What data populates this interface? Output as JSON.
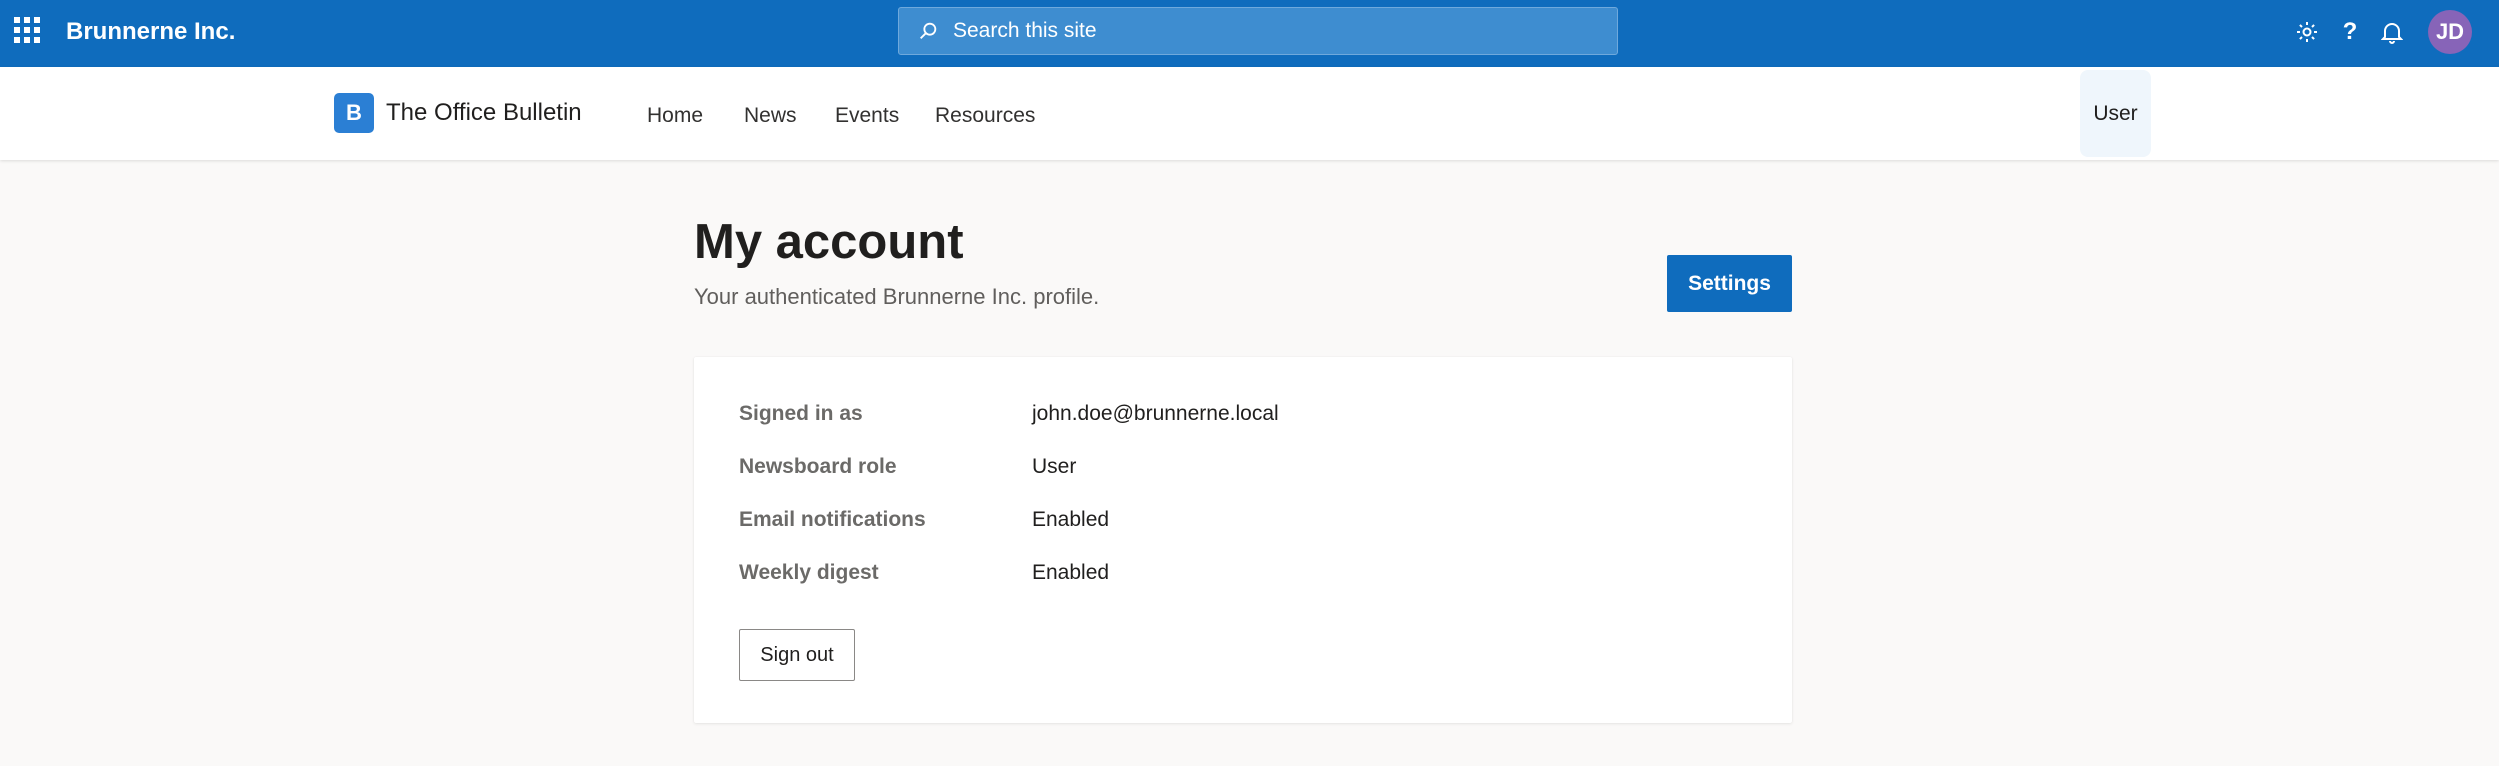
{
  "suite": {
    "brand": "Brunnerne Inc.",
    "search_placeholder": "Search this site",
    "help_glyph": "?",
    "avatar_initials": "JD",
    "icons": [
      "waffle-icon",
      "search-icon",
      "gear-icon",
      "help-icon",
      "bell-icon"
    ]
  },
  "site": {
    "logo_letter": "B",
    "title": "The Office Bulletin",
    "nav": [
      "Home",
      "News",
      "Events",
      "Resources"
    ],
    "user_tab": "User"
  },
  "main": {
    "title": "My account",
    "subtitle": "Your authenticated Brunnerne Inc. profile.",
    "settings_label": "Settings",
    "details": [
      {
        "label": "Signed in as",
        "value": "john.doe@brunnerne.local"
      },
      {
        "label": "Newsboard role",
        "value": "User"
      },
      {
        "label": "Email notifications",
        "value": "Enabled"
      },
      {
        "label": "Weekly digest",
        "value": "Enabled"
      }
    ],
    "signout_label": "Sign out"
  },
  "colors": {
    "brand_blue": "#0f6cbd",
    "avatar_purple": "#8764b8",
    "page_bg": "#faf9f8"
  }
}
